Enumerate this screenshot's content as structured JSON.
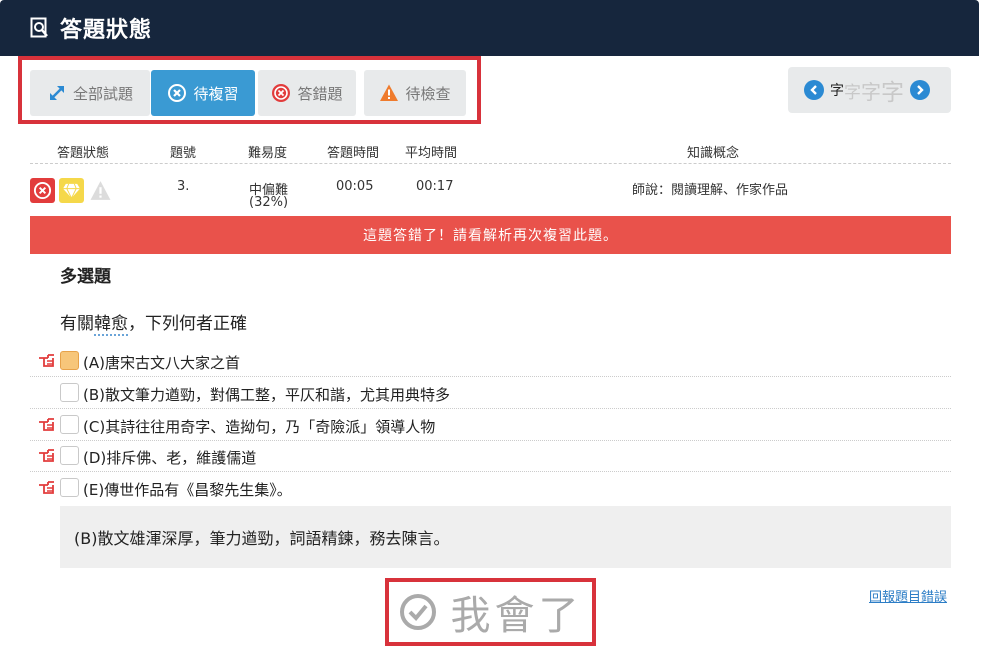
{
  "header": {
    "title": "答題狀態",
    "icon": "document-search-icon"
  },
  "tabs": [
    {
      "label": "全部試題",
      "icon": "expand-arrows-icon",
      "active": false
    },
    {
      "label": "待複習",
      "icon": "circle-x-icon",
      "active": true
    },
    {
      "label": "答錯題",
      "icon": "red-circle-x-icon",
      "active": false
    },
    {
      "label": "待檢查",
      "icon": "warning-triangle-icon",
      "active": false
    }
  ],
  "font_control": {
    "sizes": [
      "字",
      "字",
      "字",
      "字"
    ],
    "prev_icon": "chevron-left-circle-icon",
    "next_icon": "chevron-right-circle-icon"
  },
  "table": {
    "headers": [
      "答題狀態",
      "題號",
      "難易度",
      "答題時間",
      "平均時間",
      "知識概念"
    ],
    "row": {
      "number": "3.",
      "difficulty": "中偏難",
      "difficulty_pct": "(32%)",
      "answer_time": "00:05",
      "avg_time": "00:17",
      "concept": "師說：閱讀理解、作家作品",
      "status_icons": [
        "wrong-answer-icon",
        "diamond-icon",
        "warning-icon"
      ]
    }
  },
  "alert": {
    "text": "這題答錯了！請看解析再次複習此題。",
    "color": "#e9524b"
  },
  "question": {
    "type": "多選題",
    "text_before": "有關",
    "text_underlined": "韓愈",
    "text_after": "，下列何者正確"
  },
  "options": [
    {
      "letter": "(A)",
      "text": "唐宋古文八大家之首",
      "checked": true,
      "pointer": true
    },
    {
      "letter": "(B)",
      "text": "散文筆力遒勁，對偶工整，平仄和諧，尤其用典特多",
      "checked": false,
      "pointer": false
    },
    {
      "letter": "(C)",
      "text": "其詩往往用奇字、造拗句，乃「奇險派」領導人物",
      "checked": false,
      "pointer": true
    },
    {
      "letter": "(D)",
      "text": "排斥佛、老，維護儒道",
      "checked": false,
      "pointer": true
    },
    {
      "letter": "(E)",
      "text": "傳世作品有《昌黎先生集》。",
      "checked": false,
      "pointer": true
    }
  ],
  "explanation": "(B)散文雄渾深厚，筆力遒勁，詞語精鍊，務去陳言。",
  "report_link": "回報題目錯誤",
  "know_button": {
    "label": "我會了",
    "icon": "check-circle-icon"
  },
  "colors": {
    "header_bg": "#16263d",
    "active_tab": "#3a9ad3",
    "highlight_border": "#d8323b"
  }
}
